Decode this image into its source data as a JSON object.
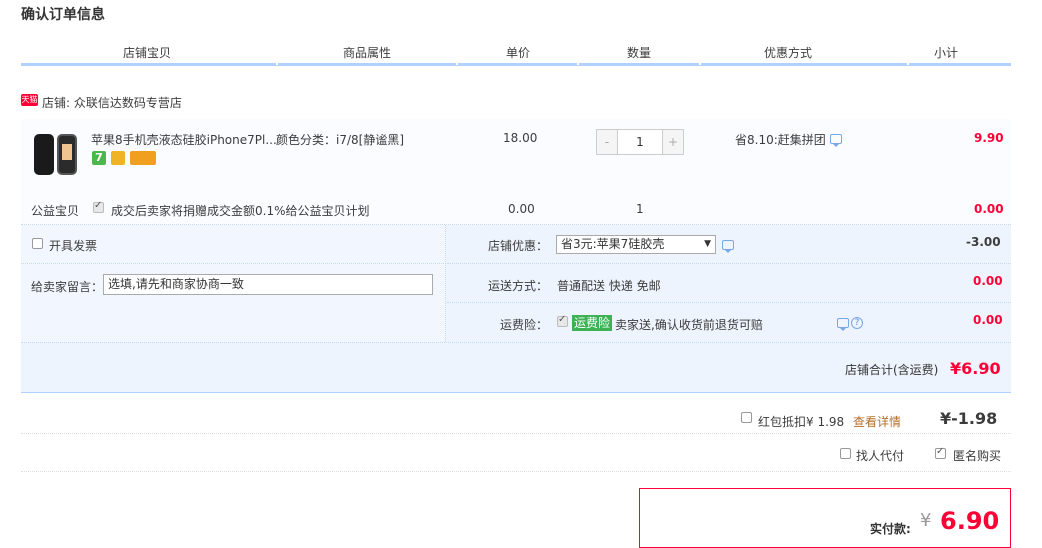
{
  "page_title": "确认订单信息",
  "columns": [
    "店铺宝贝",
    "商品属性",
    "单价",
    "数量",
    "优惠方式",
    "小计"
  ],
  "shop": {
    "badge": "天猫",
    "label": "店铺: 众联信达数码专营店"
  },
  "item": {
    "name": "苹果8手机壳液态硅胶iPhone7Pl...",
    "attr": "颜色分类：i7/8[静谧黑]",
    "price": "18.00",
    "qty": "1",
    "minus": "-",
    "plus": "+",
    "discount": "省8.10:赶集拼团",
    "subtotal": "9.90"
  },
  "charity": {
    "label": "公益宝贝",
    "text": "成交后卖家将捐赠成交金额0.1%给公益宝贝计划",
    "price": "0.00",
    "qty": "1",
    "subtotal": "0.00"
  },
  "invoice": {
    "label": "开具发票"
  },
  "message": {
    "label": "给卖家留言：",
    "placeholder": "选填,请先和商家协商一致"
  },
  "shop_discount": {
    "label": "店铺优惠：",
    "selected": "省3元:苹果7硅胶壳",
    "amount": "-3.00"
  },
  "shipping": {
    "label": "运送方式：",
    "value": "普通配送 快递 免邮",
    "amount": "0.00"
  },
  "insurance": {
    "label": "运费险：",
    "badge": "运费险",
    "text": "卖家送,确认收货前退货可赔",
    "amount": "0.00"
  },
  "shop_total": {
    "label": "店铺合计(含运费)",
    "value": "¥6.90"
  },
  "red_packet": {
    "label": "红包抵扣¥ 1.98",
    "link": "查看详情",
    "value": "¥-1.98"
  },
  "options": {
    "proxy_pay": "找人代付",
    "anonymous": "匿名购买"
  },
  "payment": {
    "label": "实付款:",
    "currency": "¥",
    "value": "6.90"
  },
  "colors": {
    "accent": "#ff0036",
    "header_line": "#b2d1ff",
    "panel_bg": "#eef4fd",
    "badge_green": "#3db255"
  },
  "icons": [
    "tmall-badge-icon",
    "chat-icon",
    "help-icon",
    "checkbox-icon",
    "dropdown-arrow-icon",
    "service-icons"
  ]
}
